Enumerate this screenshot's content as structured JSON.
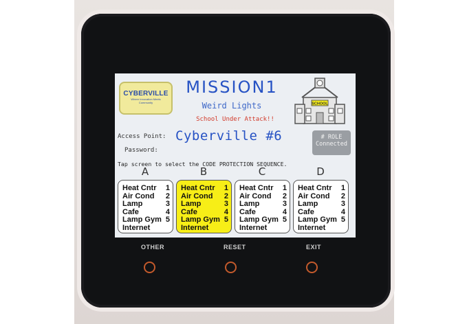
{
  "header": {
    "logo_title": "CYBERVILLE",
    "logo_tagline": "Where Innovation Meets Community",
    "mission_title": "MISSION1",
    "mission_subtitle": "Weird Lights",
    "alert": "School Under Attack!!",
    "school_sign": "SCHOOL"
  },
  "network": {
    "access_point_label": "Access Point:",
    "access_point_value": "Cyberville #6",
    "password_label": "Password:",
    "role_line1": "# ROLE",
    "role_line2": "Connected"
  },
  "instruction": "Tap screen to select the CODE PROTECTION SEQUENCE.",
  "panels": [
    {
      "letter": "A",
      "selected": false,
      "items": [
        {
          "label": "Heat Cntr",
          "num": "1"
        },
        {
          "label": "Air Cond",
          "num": "2"
        },
        {
          "label": "Lamp",
          "num": "3"
        },
        {
          "label": "Cafe",
          "num": "4"
        },
        {
          "label": "Lamp Gym",
          "num": "5"
        },
        {
          "label": "Internet",
          "num": ""
        }
      ]
    },
    {
      "letter": "B",
      "selected": true,
      "items": [
        {
          "label": "Heat Cntr",
          "num": "1"
        },
        {
          "label": "Air Cond",
          "num": "2"
        },
        {
          "label": "Lamp",
          "num": "3"
        },
        {
          "label": "Cafe",
          "num": "4"
        },
        {
          "label": "Lamp Gym",
          "num": "5"
        },
        {
          "label": "Internet",
          "num": ""
        }
      ]
    },
    {
      "letter": "C",
      "selected": false,
      "items": [
        {
          "label": "Heat Cntr",
          "num": "1"
        },
        {
          "label": "Air Cond",
          "num": "2"
        },
        {
          "label": "Lamp",
          "num": "3"
        },
        {
          "label": "Cafe",
          "num": "4"
        },
        {
          "label": "Lamp Gym",
          "num": "5"
        },
        {
          "label": "Internet",
          "num": ""
        }
      ]
    },
    {
      "letter": "D",
      "selected": false,
      "items": [
        {
          "label": "Heat Cntr",
          "num": "1"
        },
        {
          "label": "Air Cond",
          "num": "2"
        },
        {
          "label": "Lamp",
          "num": "3"
        },
        {
          "label": "Cafe",
          "num": "4"
        },
        {
          "label": "Lamp Gym",
          "num": "5"
        },
        {
          "label": "Internet",
          "num": ""
        }
      ]
    }
  ],
  "hardware_buttons": {
    "left_label": "OTHER",
    "center_label": "RESET",
    "right_label": "EXIT"
  },
  "colors": {
    "selected_panel": "#f7ee17",
    "title_blue": "#2652c4",
    "alert_red": "#d23a2a",
    "button_ring": "#c45a2c"
  }
}
